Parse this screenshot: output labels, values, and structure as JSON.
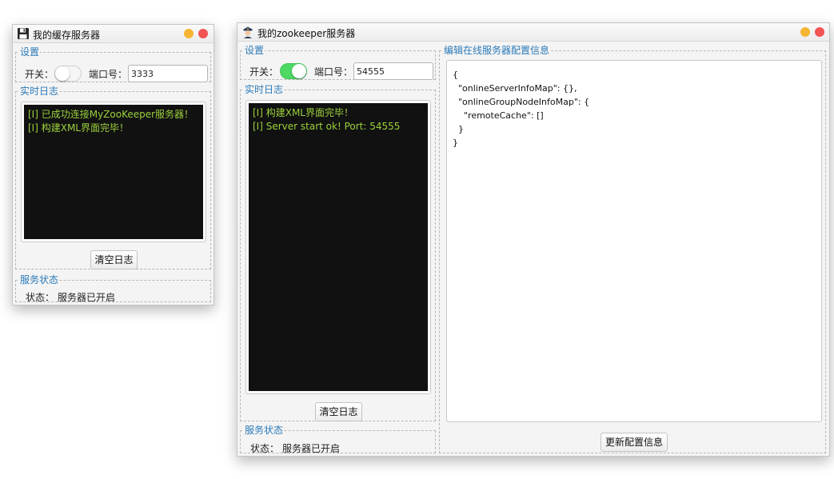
{
  "cache_window": {
    "title": "我的缓存服务器",
    "icon": "floppy-disk-icon",
    "settings": {
      "legend": "设置",
      "switch_label": "开关：",
      "switch_on": false,
      "port_label": "端口号：",
      "port_value": "3333"
    },
    "log": {
      "legend": "实时日志",
      "lines": [
        "[I] 已成功连接MyZooKeeper服务器！",
        "[I] 构建XML界面完毕！"
      ],
      "clear_button": "清空日志"
    },
    "status": {
      "legend": "服务状态",
      "label": "状态：",
      "value": "服务器已开启"
    }
  },
  "zk_window": {
    "title": "我的zookeeper服务器",
    "icon": "police-officer-icon",
    "settings": {
      "legend": "设置",
      "switch_label": "开关：",
      "switch_on": true,
      "port_label": "端口号：",
      "port_value": "54555"
    },
    "log": {
      "legend": "实时日志",
      "lines": [
        "[I] 构建XML界面完毕！",
        "[I] Server start ok! Port: 54555"
      ],
      "clear_button": "清空日志"
    },
    "status": {
      "legend": "服务状态",
      "label": "状态：",
      "value": "服务器已开启"
    },
    "config": {
      "legend": "编辑在线服务器配置信息",
      "lines": [
        "{",
        "  \"onlineServerInfoMap\": {},",
        "  \"onlineGroupNodeInfoMap\": {",
        "    \"remoteCache\": []",
        "  }",
        "}"
      ],
      "update_button": "更新配置信息"
    }
  },
  "colors": {
    "legend_text": "#2b7ab8",
    "log_text": "#9bd13c",
    "log_background": "#111111",
    "toggle_on": "#4cd964",
    "minimize_dot": "#f5b533",
    "close_dot": "#f25353"
  }
}
